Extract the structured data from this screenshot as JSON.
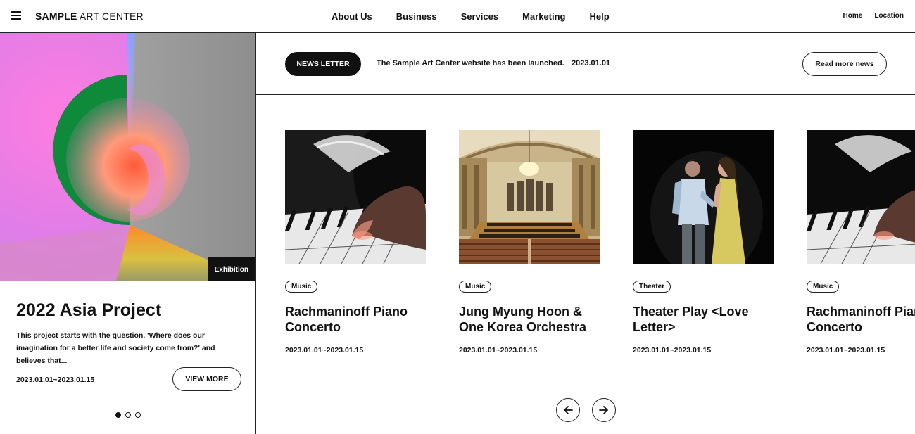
{
  "header": {
    "logo_bold": "SAMPLE",
    "logo_rest": " ART CENTER",
    "nav": [
      "About Us",
      "Business",
      "Services",
      "Marketing",
      "Help"
    ],
    "util": [
      "Home",
      "Location"
    ]
  },
  "feature": {
    "tag": "Exhibition",
    "title": "2022 Asia Project",
    "description": "This project starts with the question, 'Where does our imagination for a better life and society come from?' and believes that...",
    "date": "2023.01.01~2023.01.15",
    "button": "VIEW MORE",
    "slides": 3,
    "active_slide": 1
  },
  "newsletter": {
    "label": "NEWS LETTER",
    "headline": "The Sample Art Center website has been launched.",
    "date": "2023.01.01",
    "button": "Read more news"
  },
  "cards": [
    {
      "tag": "Music",
      "title_line1": "Rachmaninoff Piano",
      "title_line2": "Concerto",
      "date": "2023.01.01~2023.01.15",
      "image": "piano-hands"
    },
    {
      "tag": "Music",
      "title_line1": "Jung Myung Hoon &",
      "title_line2": "One Korea Orchestra",
      "date": "2023.01.01~2023.01.15",
      "image": "concert-hall"
    },
    {
      "tag": "Theater",
      "title_line1": "Theater Play <Love",
      "title_line2": "Letter>",
      "date": "2023.01.01~2023.01.15",
      "image": "stage-actors"
    },
    {
      "tag": "Music",
      "title_line1": "Rachmaninoff Piano",
      "title_line2": "Concerto",
      "date": "2023.01.01~2023.01.15",
      "image": "piano-hands"
    }
  ],
  "icons": {
    "menu": "hamburger-icon",
    "prev": "arrow-left-icon",
    "next": "arrow-right-icon"
  }
}
